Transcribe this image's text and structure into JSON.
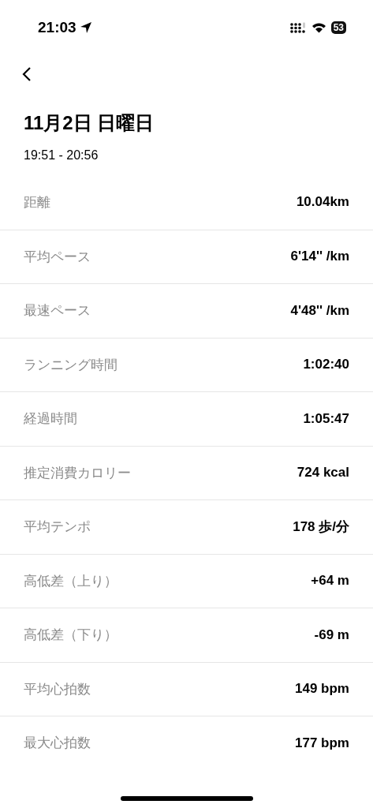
{
  "status_bar": {
    "time": "21:03",
    "battery": "53"
  },
  "header": {
    "title": "11月2日 日曜日",
    "subtitle": "19:51 - 20:56"
  },
  "stats": [
    {
      "label": "距離",
      "value": "10.04km"
    },
    {
      "label": "平均ペース",
      "value": "6'14'' /km"
    },
    {
      "label": "最速ペース",
      "value": "4'48'' /km"
    },
    {
      "label": "ランニング時間",
      "value": "1:02:40"
    },
    {
      "label": "経過時間",
      "value": "1:05:47"
    },
    {
      "label": "推定消費カロリー",
      "value": "724 kcal"
    },
    {
      "label": "平均テンポ",
      "value": "178 歩/分"
    },
    {
      "label": "高低差（上り）",
      "value": "+64 m"
    },
    {
      "label": "高低差（下り）",
      "value": "-69 m"
    },
    {
      "label": "平均心拍数",
      "value": "149 bpm"
    },
    {
      "label": "最大心拍数",
      "value": "177 bpm"
    }
  ]
}
